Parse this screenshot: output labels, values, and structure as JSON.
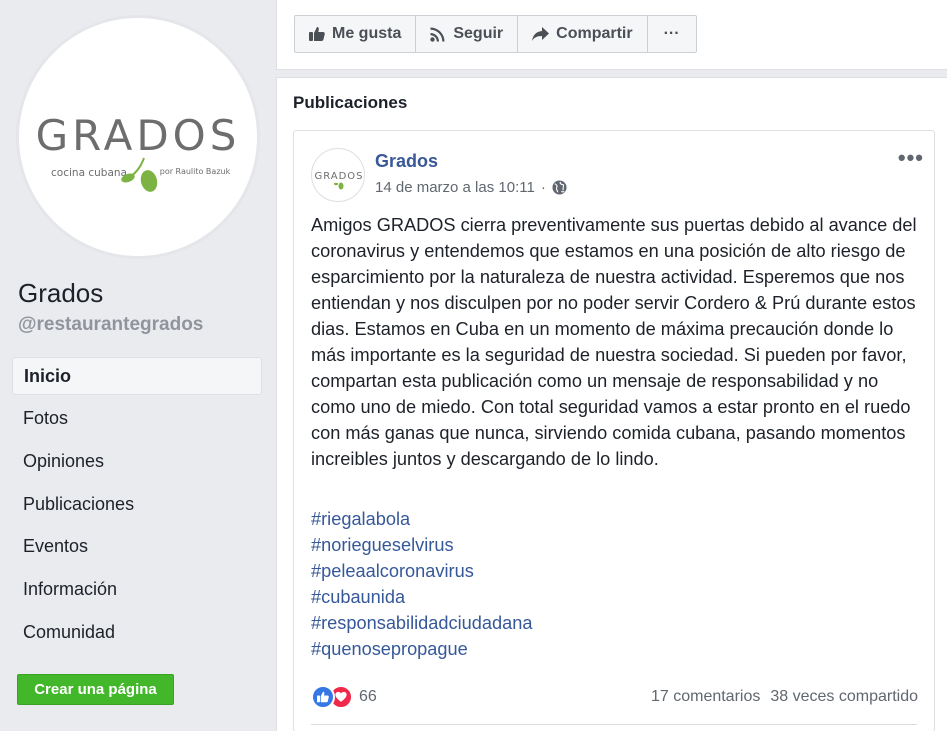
{
  "page": {
    "name": "Grados",
    "handle": "@restaurantegrados",
    "logo": {
      "wordmark": "GRADOS",
      "tagline_left": "cocina cubana",
      "tagline_right": "por Raulito Bazuk"
    }
  },
  "nav": {
    "items": [
      {
        "label": "Inicio",
        "active": true
      },
      {
        "label": "Fotos"
      },
      {
        "label": "Opiniones"
      },
      {
        "label": "Publicaciones"
      },
      {
        "label": "Eventos"
      },
      {
        "label": "Información"
      },
      {
        "label": "Comunidad"
      }
    ],
    "create_page_label": "Crear una página"
  },
  "action_bar": {
    "like_label": "Me gusta",
    "follow_label": "Seguir",
    "share_label": "Compartir",
    "more_label": "···"
  },
  "posts_section": {
    "title": "Publicaciones"
  },
  "post": {
    "author": "Grados",
    "timestamp": "14 de marzo a las 10:11",
    "meta_separator": "·",
    "menu_label": "•••",
    "body": "Amigos GRADOS cierra preventivamente sus puertas debido al avance del coronavirus y entendemos que estamos en una posición de alto riesgo de esparcimiento por la naturaleza de nuestra actividad. Esperemos que nos entiendan y nos disculpen por no poder servir Cordero & Prú durante estos dias. Estamos en Cuba en un momento de máxima precaución donde lo más importante es la seguridad de nuestra sociedad. Si pueden por favor, compartan esta publicación como un mensaje de responsabilidad y no como uno de miedo. Con total seguridad vamos a estar pronto en el ruedo con más ganas que nunca, sirviendo comida cubana, pasando momentos increibles juntos y descargando de lo lindo.",
    "hashtags": [
      "#riegalabola",
      "#noriegueselvirus",
      "#peleaalcoronavirus",
      "#cubaunida",
      "#responsabilidadciudadana",
      "#quenosepropague"
    ],
    "reaction_count": "66",
    "comments": "17 comentarios",
    "shares": "38 veces compartido"
  },
  "colors": {
    "link": "#385898",
    "hashtag": "#365899",
    "create_button": "#42b72a",
    "logo_green": "#7cb342",
    "logo_gray": "#6d6d6d"
  }
}
